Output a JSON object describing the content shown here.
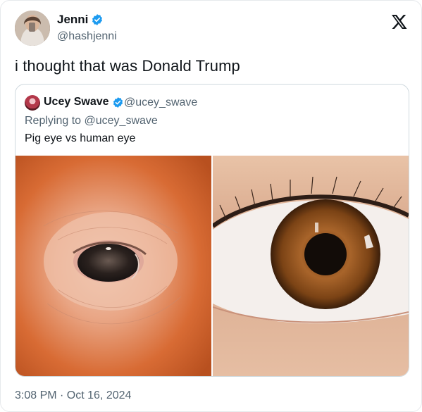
{
  "author": {
    "name": "Jenni",
    "handle": "@hashjenni",
    "verified": true
  },
  "tweet": {
    "text": "i thought that was Donald Trump",
    "timestamp": "3:08 PM · Oct 16, 2024"
  },
  "quoted": {
    "name": "Ucey Swave",
    "handle": "@ucey_swave",
    "verified": true,
    "replying_prefix": "Replying to ",
    "replying_to": "@ucey_swave",
    "text": "Pig eye vs human eye",
    "media": [
      "pig eye photo",
      "human eye photo"
    ]
  },
  "icons": {
    "brand": "x-logo-icon",
    "verified": "verified-badge-icon"
  },
  "colors": {
    "verified_blue": "#1d9bf0",
    "secondary_text": "#536471",
    "border": "#cfd9de"
  }
}
